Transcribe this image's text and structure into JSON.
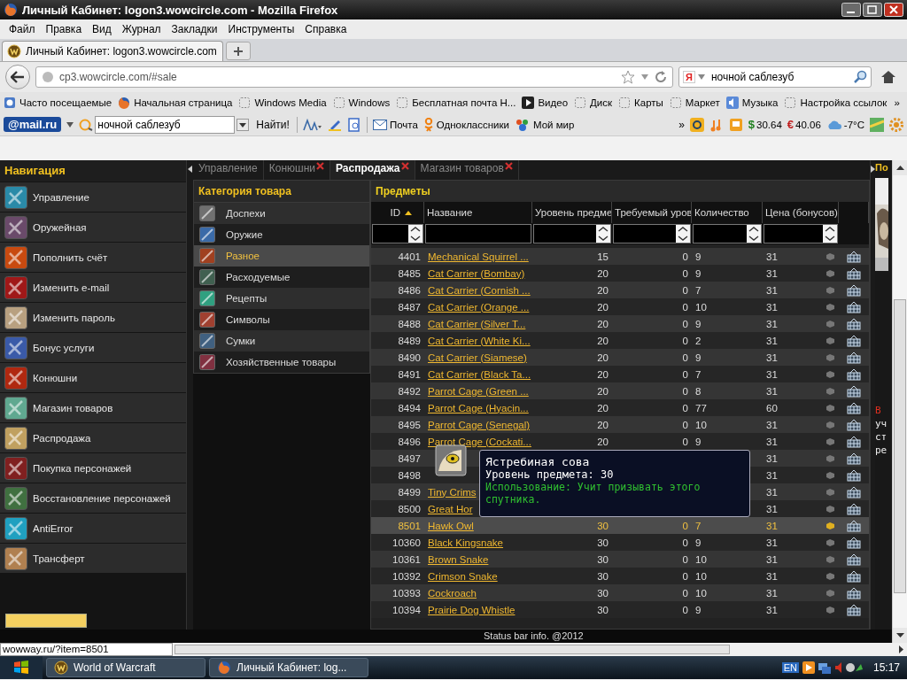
{
  "window": {
    "title": "Личный Кабинет: logon3.wowcircle.com - Mozilla Firefox"
  },
  "menu": [
    "Файл",
    "Правка",
    "Вид",
    "Журнал",
    "Закладки",
    "Инструменты",
    "Справка"
  ],
  "browser_tabs": [
    {
      "label": "Личный Кабинет: logon3.wowcircle.com",
      "selected": true
    }
  ],
  "address": {
    "url": "cp3.wowcircle.com/#sale"
  },
  "search": {
    "engine": "Я",
    "value": "ночной саблезуб"
  },
  "bookmarks": [
    {
      "label": "Часто посещаемые",
      "kind": "recent"
    },
    {
      "label": "Начальная страница",
      "kind": "firefox"
    },
    {
      "label": "Windows Media",
      "kind": "page"
    },
    {
      "label": "Windows",
      "kind": "page"
    },
    {
      "label": "Бесплатная почта Н...",
      "kind": "page"
    },
    {
      "label": "Видео",
      "kind": "play"
    },
    {
      "label": "Диск",
      "kind": "page"
    },
    {
      "label": "Карты",
      "kind": "page"
    },
    {
      "label": "Маркет",
      "kind": "page"
    },
    {
      "label": "Музыка",
      "kind": "audio"
    },
    {
      "label": "Настройка ссылок",
      "kind": "page"
    }
  ],
  "bookmarks_overflow": "»",
  "mailru_bar": {
    "logo": "@mail.ru",
    "search_value": "ночной саблезуб",
    "search_button": "Найти!",
    "links": [
      {
        "label": "Почта",
        "kind": "mail"
      },
      {
        "label": "Одноклассники",
        "kind": "ok"
      },
      {
        "label": "Мой мир",
        "kind": "world"
      }
    ],
    "overflow": "»",
    "rates": [
      {
        "symbol": "$",
        "value": "30.64"
      },
      {
        "symbol": "€",
        "value": "40.06"
      }
    ],
    "weather": "-7°C"
  },
  "navigation": {
    "title": "Навигация",
    "items": [
      "Управление",
      "Оружейная",
      "Пополнить счёт",
      "Изменить e-mail",
      "Изменить пароль",
      "Бонус услуги",
      "Конюшни",
      "Магазин товаров",
      "Распродажа",
      "Покупка персонажей",
      "Восстановление персонажей",
      "AntiError",
      "Трансферт"
    ]
  },
  "page_tabs": [
    {
      "label": "Управление",
      "selected": false,
      "closable": false
    },
    {
      "label": "Конюшни",
      "selected": false,
      "closable": true
    },
    {
      "label": "Распродажа",
      "selected": true,
      "closable": true
    },
    {
      "label": "Магазин товаров",
      "selected": false,
      "closable": true
    }
  ],
  "categories": {
    "title": "Категория товара",
    "items": [
      {
        "label": "Доспехи",
        "selected": false
      },
      {
        "label": "Оружие",
        "selected": false
      },
      {
        "label": "Разное",
        "selected": true
      },
      {
        "label": "Расходуемые",
        "selected": false
      },
      {
        "label": "Рецепты",
        "selected": false
      },
      {
        "label": "Символы",
        "selected": false
      },
      {
        "label": "Сумки",
        "selected": false
      },
      {
        "label": "Хозяйственные товары",
        "selected": false
      }
    ]
  },
  "items": {
    "title": "Предметы",
    "columns": [
      {
        "label": "ID",
        "sort_ascending": true
      },
      {
        "label": "Название"
      },
      {
        "label": "Уровень предме"
      },
      {
        "label": "Требуемый уров"
      },
      {
        "label": "Количество"
      },
      {
        "label": "Цена (бонусов)"
      }
    ],
    "rows": [
      {
        "id": "4401",
        "name": "Mechanical Squirrel ...",
        "ilvl": "15",
        "req": "0",
        "qty": "9",
        "price": "31",
        "selected": false
      },
      {
        "id": "8485",
        "name": "Cat Carrier (Bombay)",
        "ilvl": "20",
        "req": "0",
        "qty": "9",
        "price": "31",
        "selected": false
      },
      {
        "id": "8486",
        "name": "Cat Carrier (Cornish ...",
        "ilvl": "20",
        "req": "0",
        "qty": "7",
        "price": "31",
        "selected": false
      },
      {
        "id": "8487",
        "name": "Cat Carrier (Orange ...",
        "ilvl": "20",
        "req": "0",
        "qty": "10",
        "price": "31",
        "selected": false
      },
      {
        "id": "8488",
        "name": "Cat Carrier (Silver T...",
        "ilvl": "20",
        "req": "0",
        "qty": "9",
        "price": "31",
        "selected": false
      },
      {
        "id": "8489",
        "name": "Cat Carrier (White Ki...",
        "ilvl": "20",
        "req": "0",
        "qty": "2",
        "price": "31",
        "selected": false
      },
      {
        "id": "8490",
        "name": "Cat Carrier (Siamese)",
        "ilvl": "20",
        "req": "0",
        "qty": "9",
        "price": "31",
        "selected": false
      },
      {
        "id": "8491",
        "name": "Cat Carrier (Black Ta...",
        "ilvl": "20",
        "req": "0",
        "qty": "7",
        "price": "31",
        "selected": false
      },
      {
        "id": "8492",
        "name": "Parrot Cage (Green ...",
        "ilvl": "20",
        "req": "0",
        "qty": "8",
        "price": "31",
        "selected": false
      },
      {
        "id": "8494",
        "name": "Parrot Cage (Hyacin...",
        "ilvl": "20",
        "req": "0",
        "qty": "77",
        "price": "60",
        "selected": false
      },
      {
        "id": "8495",
        "name": "Parrot Cage (Senegal)",
        "ilvl": "20",
        "req": "0",
        "qty": "10",
        "price": "31",
        "selected": false
      },
      {
        "id": "8496",
        "name": "Parrot Cage (Cockati...",
        "ilvl": "20",
        "req": "0",
        "qty": "9",
        "price": "31",
        "selected": false
      },
      {
        "id": "8497",
        "price": "31",
        "selected": false
      },
      {
        "id": "8498",
        "price": "31",
        "selected": false
      },
      {
        "id": "8499",
        "name": "Tiny Crims",
        "price": "31",
        "selected": false
      },
      {
        "id": "8500",
        "name": "Great Hor",
        "price": "31",
        "selected": false
      },
      {
        "id": "8501",
        "name": "Hawk Owl",
        "ilvl": "30",
        "req": "0",
        "qty": "7",
        "price": "31",
        "selected": true
      },
      {
        "id": "10360",
        "name": "Black Kingsnake",
        "ilvl": "30",
        "req": "0",
        "qty": "9",
        "price": "31",
        "selected": false
      },
      {
        "id": "10361",
        "name": "Brown Snake",
        "ilvl": "30",
        "req": "0",
        "qty": "10",
        "price": "31",
        "selected": false
      },
      {
        "id": "10392",
        "name": "Crimson Snake",
        "ilvl": "30",
        "req": "0",
        "qty": "10",
        "price": "31",
        "selected": false
      },
      {
        "id": "10393",
        "name": "Cockroach",
        "ilvl": "30",
        "req": "0",
        "qty": "10",
        "price": "31",
        "selected": false
      },
      {
        "id": "10394",
        "name": "Prairie Dog Whistle",
        "ilvl": "30",
        "req": "0",
        "qty": "9",
        "price": "31",
        "selected": false
      }
    ]
  },
  "tooltip": {
    "title": "Ястребиная сова",
    "level": "Уровень предмета: 30",
    "use": "Использование: Учит призывать этого спутника."
  },
  "side_panel": {
    "title": "По",
    "lines": [
      {
        "text": "В",
        "kind": "alert"
      },
      {
        "text": "уч",
        "kind": "plain"
      },
      {
        "text": "ст",
        "kind": "plain"
      },
      {
        "text": "ре",
        "kind": "plain"
      }
    ]
  },
  "page_status": "Status bar info. @2012",
  "link_status": "wowway.ru/?item=8501",
  "taskbar": {
    "buttons": [
      {
        "label": "World of Warcraft",
        "kind": "game"
      },
      {
        "label": "Личный Кабинет: log...",
        "kind": "firefox"
      }
    ],
    "language": "EN",
    "clock": "15:17"
  }
}
